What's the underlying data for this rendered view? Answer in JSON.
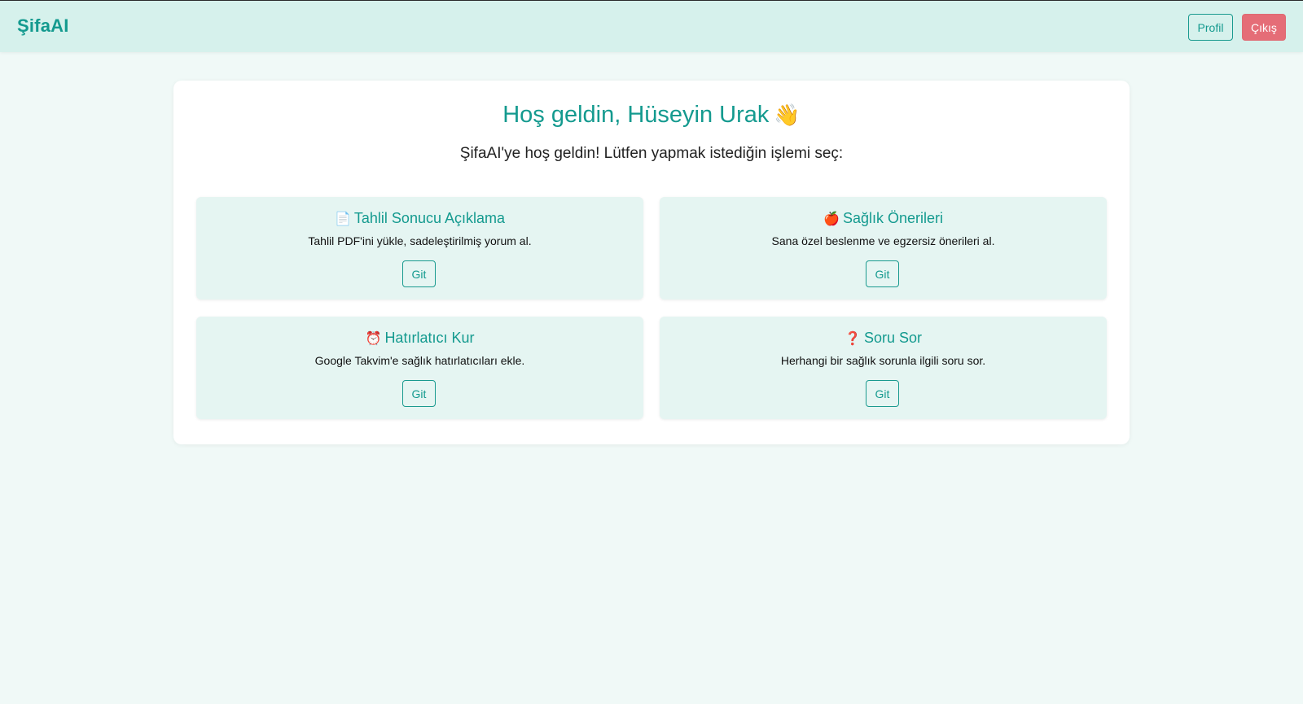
{
  "header": {
    "brand": "ŞifaAI",
    "profile_label": "Profil",
    "logout_label": "Çıkış",
    "accent_color": "#149a8f",
    "logout_color": "#e56d77"
  },
  "main": {
    "welcome_text": "Hoş geldin, Hüseyin Urak",
    "welcome_emoji": "👋",
    "subtitle": "ŞifaAI'ye hoş geldin! Lütfen yapmak istediğin işlemi seç:",
    "cards": [
      {
        "icon": "📄",
        "icon_name": "document-icon",
        "title": "Tahlil Sonucu Açıklama",
        "description": "Tahlil PDF'ini yükle, sadeleştirilmiş yorum al.",
        "button_label": "Git"
      },
      {
        "icon": "🍎",
        "icon_name": "apple-icon",
        "title": "Sağlık Önerileri",
        "description": "Sana özel beslenme ve egzersiz önerileri al.",
        "button_label": "Git"
      },
      {
        "icon": "⏰",
        "icon_name": "alarm-clock-icon",
        "title": "Hatırlatıcı Kur",
        "description": "Google Takvim'e sağlık hatırlatıcıları ekle.",
        "button_label": "Git"
      },
      {
        "icon": "❓",
        "icon_name": "question-mark-icon",
        "title": "Soru Sor",
        "description": "Herhangi bir sağlık sorunla ilgili soru sor.",
        "button_label": "Git"
      }
    ]
  }
}
